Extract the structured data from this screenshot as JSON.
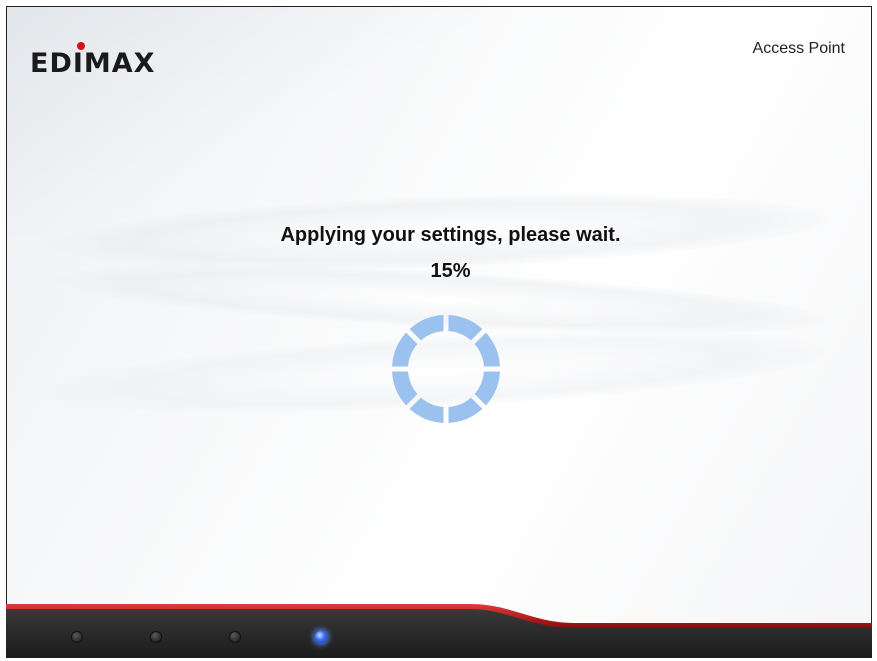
{
  "header": {
    "brand": "EDIMAX",
    "mode_label": "Access Point"
  },
  "status": {
    "message": "Applying your settings, please wait.",
    "progress_text": "15%",
    "progress": 0.15
  },
  "spinner": {
    "segments": 8,
    "color": "#9bc2ee"
  },
  "footer": {
    "leds": [
      {
        "name": "led-1",
        "active": false
      },
      {
        "name": "led-2",
        "active": false
      },
      {
        "name": "led-3",
        "active": false
      },
      {
        "name": "led-4",
        "active": true
      }
    ],
    "accent_color": "#c8151b"
  }
}
